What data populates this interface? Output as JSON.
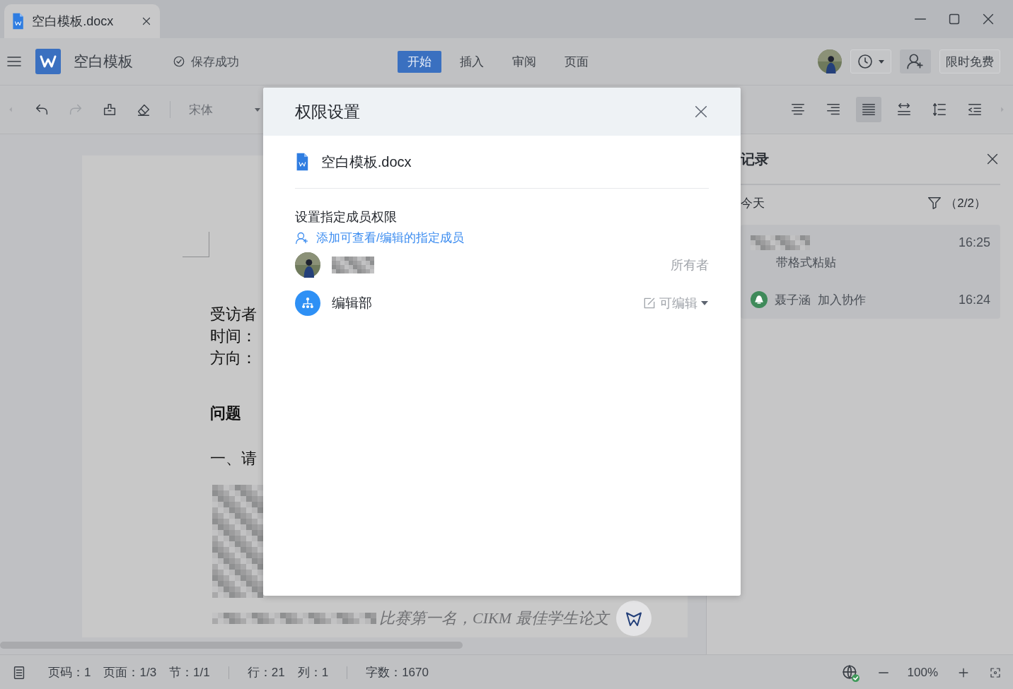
{
  "tab": {
    "title": "空白模板.docx"
  },
  "header": {
    "doc_title": "空白模板",
    "save_status": "保存成功",
    "menu": [
      {
        "label": "开始",
        "selected": true
      },
      {
        "label": "插入",
        "selected": false
      },
      {
        "label": "审阅",
        "selected": false
      },
      {
        "label": "页面",
        "selected": false
      }
    ],
    "free_button": "限时免费"
  },
  "toolbar": {
    "font": "宋体",
    "tools": [
      {
        "kind": "center",
        "selected": false
      },
      {
        "kind": "right",
        "selected": false
      },
      {
        "kind": "justify",
        "selected": true
      },
      {
        "kind": "spacing",
        "selected": false
      },
      {
        "kind": "line-height",
        "selected": false
      },
      {
        "kind": "outdent",
        "selected": false
      }
    ]
  },
  "document": {
    "info_lines": [
      "受访者",
      "时间：",
      "方向："
    ],
    "heading": "问题",
    "question": "一、请",
    "italic_tail": "比赛第一名，CIKM 最佳学生论文"
  },
  "history_panel": {
    "title": "记录",
    "day": "今天",
    "filter_count": "（2/2）",
    "entries": [
      {
        "kind": "edit",
        "action": "带格式粘贴",
        "time": "16:25"
      },
      {
        "kind": "join",
        "name": "聂子涵",
        "action": "加入协作",
        "time": "16:24"
      }
    ]
  },
  "status_bar": {
    "groups": [
      [
        "页码：1",
        "页面：1/3",
        "节：1/1"
      ],
      [
        "行：21",
        "列：1"
      ],
      [
        "字数：1670"
      ]
    ],
    "zoom": "100%"
  },
  "dialog": {
    "title": "权限设置",
    "file_name": "空白模板.docx",
    "section_label": "设置指定成员权限",
    "add_link": "添加可查看/编辑的指定成员",
    "members": [
      {
        "kind": "user",
        "role": "所有者"
      },
      {
        "kind": "group",
        "name": "编辑部",
        "permission": "可编辑"
      }
    ]
  }
}
